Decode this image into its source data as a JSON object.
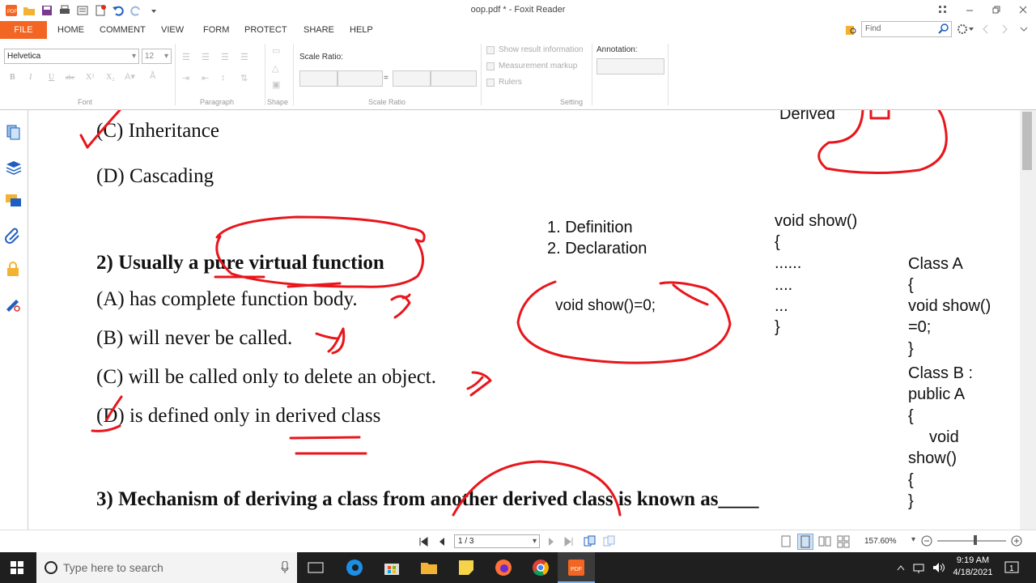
{
  "window": {
    "title": "oop.pdf * - Foxit Reader"
  },
  "ribbon_tabs": [
    "FILE",
    "HOME",
    "COMMENT",
    "VIEW",
    "FORM",
    "PROTECT",
    "SHARE",
    "HELP"
  ],
  "search": {
    "placeholder": "Find"
  },
  "ribbon": {
    "font_name": "Helvetica",
    "font_size": "12",
    "groups": {
      "font": "Font",
      "paragraph": "Paragraph",
      "shape": "Shape",
      "scale_ratio": "Scale Ratio",
      "setting": "Setting"
    },
    "scale_ratio_label": "Scale Ratio:",
    "scale_equals": "=",
    "checkboxes": [
      "Show result information",
      "Measurement markup",
      "Rulers"
    ],
    "annotation_label": "Annotation:",
    "format_buttons": [
      "B",
      "I",
      "U",
      "abc",
      "X²",
      "X₂"
    ]
  },
  "document": {
    "q1_options": [
      "(C) Inheritance",
      "(D) Cascading"
    ],
    "derived_label": "Derived",
    "q2": {
      "question": "2) Usually a pure virtual function",
      "options": [
        "(A) has complete function body.",
        "(B) will never be called.",
        "(C) will be called only to delete an object.",
        "(D) is defined only in derived class"
      ]
    },
    "q3": {
      "question": "3) Mechanism of deriving a class from another derived class is known as____"
    },
    "notes": {
      "list": [
        "1. Definition",
        "2. Declaration"
      ],
      "pure_virtual_code": "void show()=0;",
      "code_block": [
        "void show()",
        "{",
        "......",
        "....",
        "...",
        "}"
      ],
      "class_block": [
        "Class A",
        "{",
        "void show()",
        "=0;",
        "}",
        "Class B :",
        "public A",
        "{",
        "void",
        "show()",
        "{",
        "}"
      ]
    }
  },
  "statusbar": {
    "page": "1 / 3",
    "zoom": "157.60%"
  },
  "taskbar": {
    "search_placeholder": "Type here to search",
    "time": "9:19 AM",
    "date": "4/18/2021"
  },
  "colors": {
    "accent": "#f26522",
    "ink": "#e8161c",
    "taskbar": "#1f1f1f"
  }
}
